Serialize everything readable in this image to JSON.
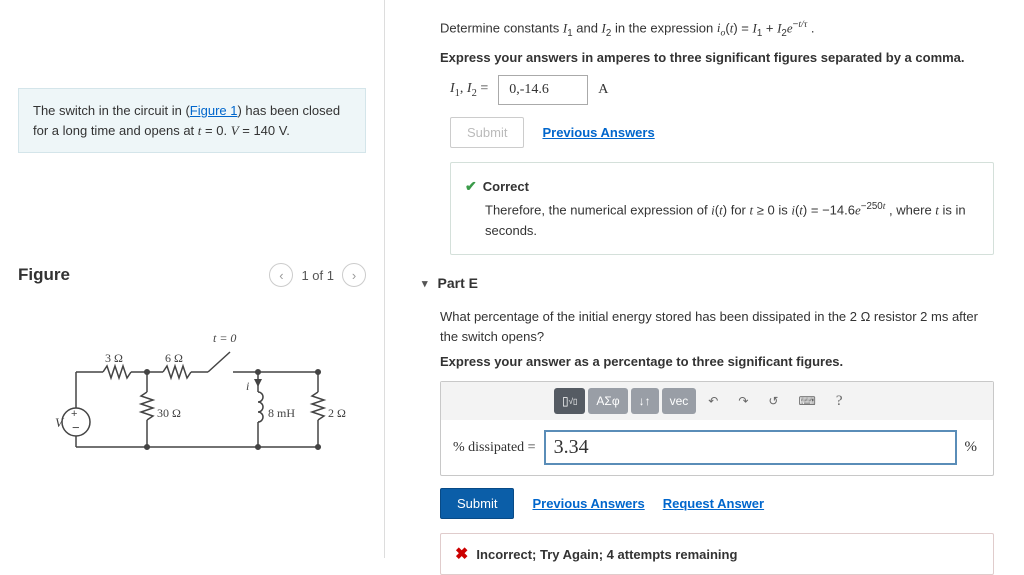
{
  "problem": {
    "prefix": "The switch in the circuit in (",
    "figure_link": "Figure 1",
    "suffix_html": ") has been closed for a long time and opens at <span class='ital'>t</span> = 0. <span class='ital'>V</span> = 140 V."
  },
  "figure": {
    "title": "Figure",
    "pager": "1 of 1"
  },
  "partD": {
    "question_html": "Determine constants <span class='ital'>I</span><sub>1</sub> and <span class='ital'>I</span><sub>2</sub> in the expression <span class='ital'>i<sub>o</sub></span>(<span class='ital'>t</span>) = <span class='ital'>I</span><sub>1</sub> + <span class='ital'>I</span><sub>2</sub><span class='ital'>e</span><sup>−<span class='ital'>t/τ</span></sup> .",
    "instruction": "Express your answers in amperes to three significant figures separated by a comma.",
    "label_html": "<span class='ital'>I</span><sub>1</sub>, <span class='ital'>I</span><sub>2</sub> =",
    "value": "0,-14.6",
    "unit": "A",
    "submit": "Submit",
    "prev": "Previous Answers",
    "correct": "Correct",
    "feedback_html": "Therefore, the numerical expression of <span class='ital'>i</span>(<span class='ital'>t</span>) for <span class='ital'>t</span> ≥ 0 is <span class='ital'>i</span>(<span class='ital'>t</span>) = −14.6<span class='ital'>e</span><sup>−250<span class='ital'>t</span></sup> , where <span class='ital'>t</span> is in seconds."
  },
  "partE": {
    "header": "Part E",
    "question_html": "What percentage of the initial energy stored has been dissipated in the 2 Ω resistor 2 ms after the switch opens?",
    "instruction": "Express your answer as a percentage to three significant figures.",
    "toolbar": {
      "greek": "ΑΣφ",
      "vec": "vec",
      "help": "?"
    },
    "prompt": "% dissipated =",
    "value": "3.34",
    "unit": "%",
    "submit": "Submit",
    "prev": "Previous Answers",
    "request": "Request Answer",
    "incorrect": "Incorrect; Try Again; 4 attempts remaining"
  },
  "circuit": {
    "t0": "t = 0",
    "r3": "3 Ω",
    "r6": "6 Ω",
    "r30": "30 Ω",
    "l8": "8 mH",
    "r2": "2 Ω",
    "v": "V",
    "i": "i"
  }
}
